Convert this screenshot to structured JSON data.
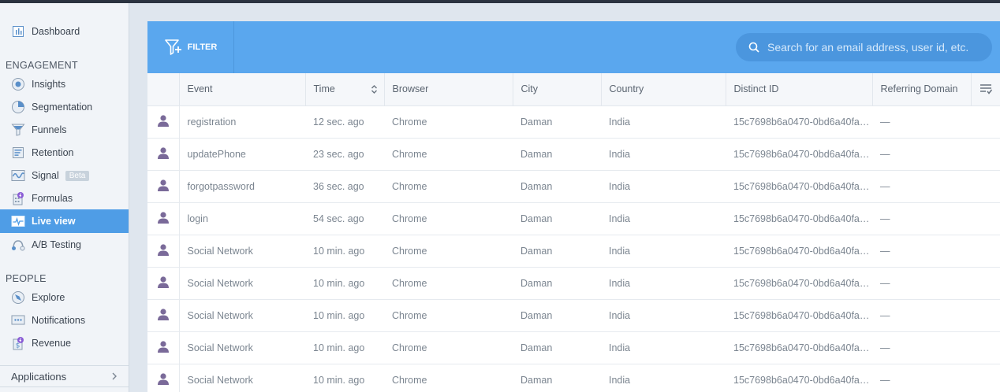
{
  "sidebar": {
    "dashboard": "Dashboard",
    "engagement_label": "ENGAGEMENT",
    "engagement_items": [
      {
        "label": "Insights",
        "icon": "insights-icon"
      },
      {
        "label": "Segmentation",
        "icon": "pie-chart-icon"
      },
      {
        "label": "Funnels",
        "icon": "funnel-icon"
      },
      {
        "label": "Retention",
        "icon": "retention-grid-icon"
      },
      {
        "label": "Signal",
        "icon": "signal-wave-icon",
        "badge": "Beta"
      },
      {
        "label": "Formulas",
        "icon": "formulas-icon"
      },
      {
        "label": "Live view",
        "icon": "live-view-icon",
        "active": true
      },
      {
        "label": "A/B Testing",
        "icon": "ab-testing-icon"
      }
    ],
    "people_label": "PEOPLE",
    "people_items": [
      {
        "label": "Explore",
        "icon": "explore-icon"
      },
      {
        "label": "Notifications",
        "icon": "notifications-icon"
      },
      {
        "label": "Revenue",
        "icon": "revenue-icon"
      }
    ],
    "applications": "Applications"
  },
  "toolbar": {
    "filter_label": "FILTER",
    "search_placeholder": "Search for an email address, user id, etc."
  },
  "table": {
    "columns": [
      "Event",
      "Time",
      "Browser",
      "City",
      "Country",
      "Distinct ID",
      "Referring Domain"
    ],
    "rows": [
      {
        "event": "registration",
        "time": "12 sec. ago",
        "browser": "Chrome",
        "city": "Daman",
        "country": "India",
        "distinct_id": "15c7698b6a0470-0bd6a40fa…",
        "referring_domain": "—"
      },
      {
        "event": "updatePhone",
        "time": "23 sec. ago",
        "browser": "Chrome",
        "city": "Daman",
        "country": "India",
        "distinct_id": "15c7698b6a0470-0bd6a40fa…",
        "referring_domain": "—"
      },
      {
        "event": "forgotpassword",
        "time": "36 sec. ago",
        "browser": "Chrome",
        "city": "Daman",
        "country": "India",
        "distinct_id": "15c7698b6a0470-0bd6a40fa…",
        "referring_domain": "—"
      },
      {
        "event": "login",
        "time": "54 sec. ago",
        "browser": "Chrome",
        "city": "Daman",
        "country": "India",
        "distinct_id": "15c7698b6a0470-0bd6a40fa…",
        "referring_domain": "—"
      },
      {
        "event": "Social Network",
        "time": "10 min. ago",
        "browser": "Chrome",
        "city": "Daman",
        "country": "India",
        "distinct_id": "15c7698b6a0470-0bd6a40fa…",
        "referring_domain": "—"
      },
      {
        "event": "Social Network",
        "time": "10 min. ago",
        "browser": "Chrome",
        "city": "Daman",
        "country": "India",
        "distinct_id": "15c7698b6a0470-0bd6a40fa…",
        "referring_domain": "—"
      },
      {
        "event": "Social Network",
        "time": "10 min. ago",
        "browser": "Chrome",
        "city": "Daman",
        "country": "India",
        "distinct_id": "15c7698b6a0470-0bd6a40fa…",
        "referring_domain": "—"
      },
      {
        "event": "Social Network",
        "time": "10 min. ago",
        "browser": "Chrome",
        "city": "Daman",
        "country": "India",
        "distinct_id": "15c7698b6a0470-0bd6a40fa…",
        "referring_domain": "—"
      },
      {
        "event": "Social Network",
        "time": "10 min. ago",
        "browser": "Chrome",
        "city": "Daman",
        "country": "India",
        "distinct_id": "15c7698b6a0470-0bd6a40fa…",
        "referring_domain": "—"
      }
    ]
  },
  "colors": {
    "accent": "#5aa7ee",
    "active_nav": "#4f9de6",
    "user_icon": "#7a6a99"
  }
}
